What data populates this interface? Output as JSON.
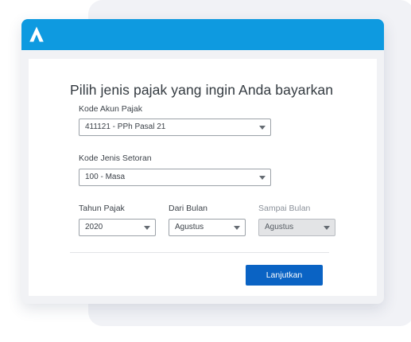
{
  "app": {
    "logo_icon": "brand-a-logo-icon",
    "header_color": "#0e9ae0",
    "button_color": "#0a63c4"
  },
  "form": {
    "heading": "Pilih jenis pajak yang ingin Anda bayarkan",
    "kode_akun_pajak": {
      "label": "Kode Akun Pajak",
      "value": "411121 - PPh Pasal 21"
    },
    "kode_jenis_setoran": {
      "label": "Kode Jenis Setoran",
      "value": "100 - Masa"
    },
    "tahun_pajak": {
      "label": "Tahun Pajak",
      "value": "2020"
    },
    "dari_bulan": {
      "label": "Dari Bulan",
      "value": "Agustus"
    },
    "sampai_bulan": {
      "label": "Sampai Bulan",
      "value": "Agustus",
      "disabled": true
    },
    "submit_label": "Lanjutkan"
  }
}
